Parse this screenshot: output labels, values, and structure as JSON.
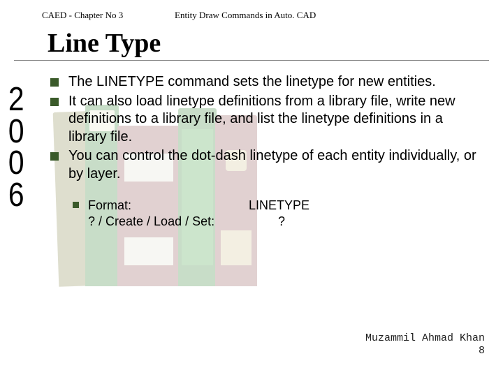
{
  "header": {
    "chapter": "CAED  - Chapter No 3",
    "subject": "Entity Draw Commands in Auto. CAD"
  },
  "title": "Line Type",
  "year": {
    "d1": "2",
    "d2": "0",
    "d3": "0",
    "d4": "6"
  },
  "bullets": {
    "b1": "The LINETYPE command sets the linetype for new entities.",
    "b2": "It can also load linetype definitions from a library file, write new definitions to a library file, and list the linetype definitions in a library file.",
    "b3": "You can control the dot-dash linetype of each entity individually, or by layer."
  },
  "format": {
    "l1_left": "Format:",
    "l1_right": "LINETYPE",
    "l2_left": "? / Create / Load / Set:",
    "l2_right": "?"
  },
  "footer": {
    "author": "Muzammil Ahmad Khan",
    "page": "8"
  }
}
